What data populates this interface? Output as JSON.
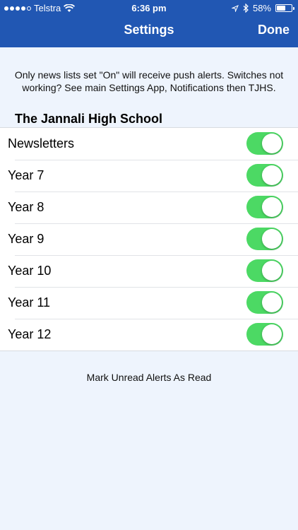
{
  "status_bar": {
    "signal_dots_filled": 4,
    "signal_dots_total": 5,
    "carrier": "Telstra",
    "time": "6:36 pm",
    "battery_percent": "58%",
    "battery_level": 0.58
  },
  "nav": {
    "title": "Settings",
    "done_label": "Done"
  },
  "notice": "Only news lists set \"On\" will receive push alerts. Switches not working? See main Settings App, Notifications then TJHS.",
  "section": {
    "title": "The Jannali High School",
    "items": [
      {
        "label": "Newsletters",
        "on": true
      },
      {
        "label": "Year 7",
        "on": true
      },
      {
        "label": "Year 8",
        "on": true
      },
      {
        "label": "Year 9",
        "on": true
      },
      {
        "label": "Year 10",
        "on": true
      },
      {
        "label": "Year 11",
        "on": true
      },
      {
        "label": "Year 12",
        "on": true
      }
    ]
  },
  "mark_read_label": "Mark Unread Alerts As Read",
  "colors": {
    "nav_bar": "#2157b3",
    "toggle_on": "#4cd964",
    "background": "#eef4fd"
  }
}
